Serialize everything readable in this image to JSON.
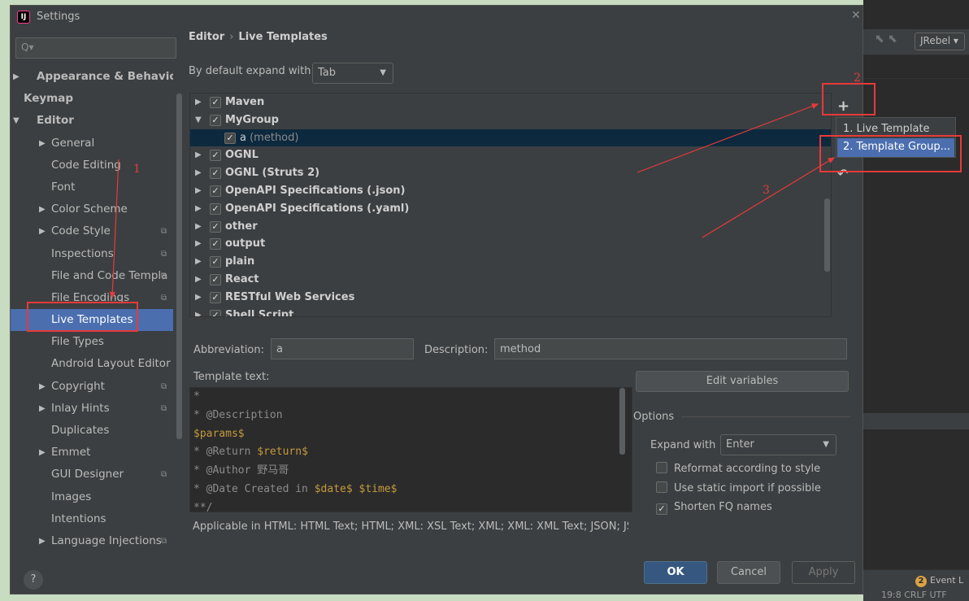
{
  "window": {
    "title": "Settings",
    "app_icon": "intellij-icon"
  },
  "search": {
    "placeholder": ""
  },
  "sidebar": {
    "items": [
      {
        "label": "Appearance & Behavior",
        "level": "top",
        "arrow": "▶"
      },
      {
        "label": "Keymap",
        "level": "top",
        "arrow": ""
      },
      {
        "label": "Editor",
        "level": "top",
        "arrow": "▼"
      },
      {
        "label": "General",
        "level": "child",
        "arrow": "▶"
      },
      {
        "label": "Code Editing",
        "level": "child",
        "arrow": ""
      },
      {
        "label": "Font",
        "level": "child",
        "arrow": ""
      },
      {
        "label": "Color Scheme",
        "level": "child",
        "arrow": "▶"
      },
      {
        "label": "Code Style",
        "level": "child",
        "arrow": "▶",
        "project": true
      },
      {
        "label": "Inspections",
        "level": "child",
        "arrow": "",
        "project": true
      },
      {
        "label": "File and Code Templa",
        "level": "child",
        "arrow": "",
        "project": true
      },
      {
        "label": "File Encodings",
        "level": "child",
        "arrow": "",
        "project": true
      },
      {
        "label": "Live Templates",
        "level": "child",
        "arrow": "",
        "selected": true
      },
      {
        "label": "File Types",
        "level": "child",
        "arrow": ""
      },
      {
        "label": "Android Layout Editor",
        "level": "child",
        "arrow": ""
      },
      {
        "label": "Copyright",
        "level": "child",
        "arrow": "▶",
        "project": true
      },
      {
        "label": "Inlay Hints",
        "level": "child",
        "arrow": "▶",
        "project": true
      },
      {
        "label": "Duplicates",
        "level": "child",
        "arrow": ""
      },
      {
        "label": "Emmet",
        "level": "child",
        "arrow": "▶"
      },
      {
        "label": "GUI Designer",
        "level": "child",
        "arrow": "",
        "project": true
      },
      {
        "label": "Images",
        "level": "child",
        "arrow": ""
      },
      {
        "label": "Intentions",
        "level": "child",
        "arrow": ""
      },
      {
        "label": "Language Injections",
        "level": "child",
        "arrow": "▶",
        "project": true
      }
    ]
  },
  "breadcrumb": {
    "parent": "Editor",
    "separator": "›",
    "current": "Live Templates"
  },
  "expand_default": {
    "label": "By default expand with",
    "value": "Tab"
  },
  "tree": {
    "rows": [
      {
        "name": "Maven",
        "arrow": "▶",
        "checked": "✓"
      },
      {
        "name": "MyGroup",
        "arrow": "▼",
        "checked": "✓"
      },
      {
        "name": "a",
        "desc": "(method)",
        "child": true,
        "checked": "✓",
        "selected": true
      },
      {
        "name": "OGNL",
        "arrow": "▶",
        "checked": "✓"
      },
      {
        "name": "OGNL (Struts 2)",
        "arrow": "▶",
        "checked": "✓"
      },
      {
        "name": "OpenAPI Specifications (.json)",
        "arrow": "▶",
        "checked": "✓"
      },
      {
        "name": "OpenAPI Specifications (.yaml)",
        "arrow": "▶",
        "checked": "✓"
      },
      {
        "name": "other",
        "arrow": "▶",
        "checked": "✓"
      },
      {
        "name": "output",
        "arrow": "▶",
        "checked": "✓"
      },
      {
        "name": "plain",
        "arrow": "▶",
        "checked": "✓"
      },
      {
        "name": "React",
        "arrow": "▶",
        "checked": "✓"
      },
      {
        "name": "RESTful Web Services",
        "arrow": "▶",
        "checked": "✓"
      },
      {
        "name": "Shell Script",
        "arrow": "▶",
        "checked": "✓"
      }
    ]
  },
  "toolbar": {
    "add": "+",
    "remove": "−",
    "revert": "↶"
  },
  "popup": {
    "live_template": "1. Live Template",
    "template_group": "2. Template Group..."
  },
  "form": {
    "abbreviation_label": "Abbreviation:",
    "abbreviation_value": "a",
    "description_label": "Description:",
    "description_value": "method",
    "template_text_label": "Template text:",
    "code_lines": [
      [
        {
          "t": "*",
          "c": "comment"
        }
      ],
      [
        {
          "t": "* @Description",
          "c": "comment"
        }
      ],
      [
        {
          "t": "$params$",
          "c": "var"
        }
      ],
      [
        {
          "t": "* @Return ",
          "c": "comment"
        },
        {
          "t": "$return$",
          "c": "var"
        }
      ],
      [
        {
          "t": "* @Author 野马哥",
          "c": "comment"
        }
      ],
      [
        {
          "t": "* @Date Created in ",
          "c": "comment"
        },
        {
          "t": "$date$ $time$",
          "c": "var"
        }
      ],
      [
        {
          "t": "**/",
          "c": "comment"
        }
      ]
    ],
    "applicable": "Applicable in HTML: HTML Text; HTML; XML: XSL Text; XML; XML: XML Text; JSON; JSC",
    "edit_variables": "Edit variables"
  },
  "options": {
    "title": "Options",
    "expand_with_label": "Expand with",
    "expand_with_value": "Enter",
    "reformat": {
      "label": "Reformat according to style",
      "checked": ""
    },
    "static_import": {
      "label": "Use static import if possible",
      "checked": ""
    },
    "shorten_fq": {
      "label": "Shorten FQ names",
      "checked": "✓"
    }
  },
  "buttons": {
    "ok": "OK",
    "cancel": "Cancel",
    "apply": "Apply",
    "help": "?"
  },
  "ide": {
    "toolbar_combo": "JRebel ▾",
    "event_badge": "2",
    "event_log": "Event L",
    "status": "19:8  CRLF  UTF"
  },
  "annotations": {
    "n1": "1",
    "n2": "2",
    "n3": "3",
    "color": "#e63a3a"
  }
}
